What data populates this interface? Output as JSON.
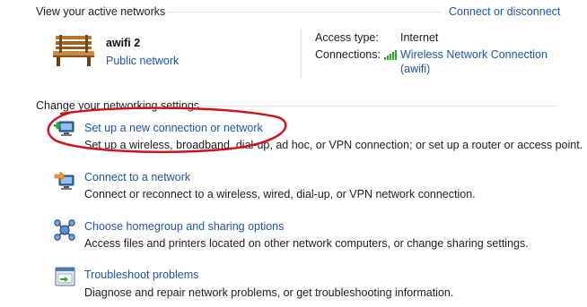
{
  "active_networks": {
    "header": "View your active networks",
    "connect_link": "Connect or disconnect",
    "network": {
      "name": "awifi  2",
      "type_link": "Public network",
      "icon": "park-bench-icon"
    },
    "details": {
      "access_type_label": "Access type:",
      "access_type_value": "Internet",
      "connections_label": "Connections:",
      "connection_link_line1": "Wireless Network Connection",
      "connection_link_line2": "(awifi)",
      "signal_icon": "wifi-signal-icon"
    }
  },
  "settings": {
    "header": "Change your networking settings",
    "items": [
      {
        "title": "Set up a new connection or network",
        "description": "Set up a wireless, broadband, dial-up, ad hoc, or VPN connection; or set up a router or access point.",
        "icon": "new-connection-icon"
      },
      {
        "title": "Connect to a network",
        "description": "Connect or reconnect to a wireless, wired, dial-up, or VPN network connection.",
        "icon": "connect-network-icon"
      },
      {
        "title": "Choose homegroup and sharing options",
        "description": "Access files and printers located on other network computers, or change sharing settings.",
        "icon": "homegroup-icon"
      },
      {
        "title": "Troubleshoot problems",
        "description": "Diagnose and repair network problems, or get troubleshooting information.",
        "icon": "troubleshoot-icon"
      }
    ]
  },
  "colors": {
    "link": "#1e55a8",
    "highlight_ellipse": "#d0101a"
  }
}
